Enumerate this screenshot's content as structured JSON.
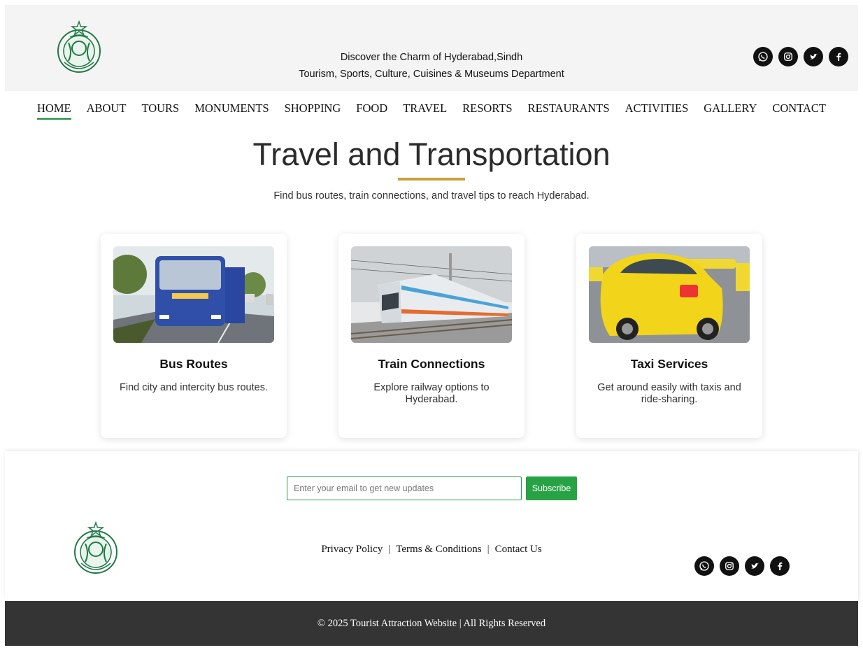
{
  "header": {
    "tagline_line1": "Discover the Charm of Hyderabad,Sindh",
    "tagline_line2": "Tourism, Sports, Culture, Cuisines & Museums Department",
    "socials": [
      "whatsapp-icon",
      "instagram-icon",
      "twitter-icon",
      "facebook-icon"
    ]
  },
  "nav": {
    "items": [
      {
        "label": "HOME"
      },
      {
        "label": "ABOUT"
      },
      {
        "label": "TOURS"
      },
      {
        "label": "MONUMENTS"
      },
      {
        "label": "SHOPPING"
      },
      {
        "label": "FOOD"
      },
      {
        "label": "TRAVEL"
      },
      {
        "label": "RESORTS"
      },
      {
        "label": "RESTAURANTS"
      },
      {
        "label": "ACTIVITIES"
      },
      {
        "label": "GALLERY"
      },
      {
        "label": "CONTACT"
      }
    ],
    "active": "HOME"
  },
  "hero": {
    "title": "Travel and Transportation",
    "subtitle": "Find bus routes, train connections, and travel tips to reach Hyderabad."
  },
  "cards": [
    {
      "title": "Bus Routes",
      "text": "Find city and intercity bus routes.",
      "image": "bus-photo"
    },
    {
      "title": "Train Connections",
      "text": "Explore railway options to Hyderabad.",
      "image": "train-photo"
    },
    {
      "title": "Taxi Services",
      "text": "Get around easily with taxis and ride-sharing.",
      "image": "taxi-photo"
    }
  ],
  "footer": {
    "email_placeholder": "Enter your email to get new updates",
    "subscribe_label": "Subscribe",
    "links": [
      "Privacy Policy",
      "Terms & Conditions",
      "Contact Us"
    ],
    "separator": "|",
    "copyright": "© 2025 Tourist Attraction Website | All Rights Reserved"
  },
  "colors": {
    "accent_green": "#27a245",
    "title_underline": "#c9a03b",
    "footer_dark": "#343434",
    "emblem_green": "#1e7a45"
  }
}
